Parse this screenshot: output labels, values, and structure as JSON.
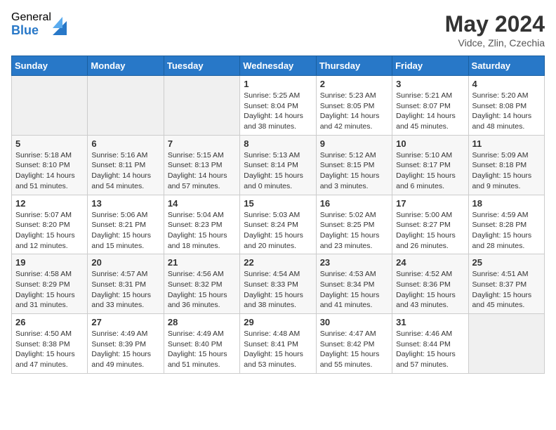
{
  "logo": {
    "general": "General",
    "blue": "Blue"
  },
  "header": {
    "month_year": "May 2024",
    "location": "Vidce, Zlin, Czechia"
  },
  "weekdays": [
    "Sunday",
    "Monday",
    "Tuesday",
    "Wednesday",
    "Thursday",
    "Friday",
    "Saturday"
  ],
  "weeks": [
    [
      {
        "day": "",
        "info": ""
      },
      {
        "day": "",
        "info": ""
      },
      {
        "day": "",
        "info": ""
      },
      {
        "day": "1",
        "info": "Sunrise: 5:25 AM\nSunset: 8:04 PM\nDaylight: 14 hours and 38 minutes."
      },
      {
        "day": "2",
        "info": "Sunrise: 5:23 AM\nSunset: 8:05 PM\nDaylight: 14 hours and 42 minutes."
      },
      {
        "day": "3",
        "info": "Sunrise: 5:21 AM\nSunset: 8:07 PM\nDaylight: 14 hours and 45 minutes."
      },
      {
        "day": "4",
        "info": "Sunrise: 5:20 AM\nSunset: 8:08 PM\nDaylight: 14 hours and 48 minutes."
      }
    ],
    [
      {
        "day": "5",
        "info": "Sunrise: 5:18 AM\nSunset: 8:10 PM\nDaylight: 14 hours and 51 minutes."
      },
      {
        "day": "6",
        "info": "Sunrise: 5:16 AM\nSunset: 8:11 PM\nDaylight: 14 hours and 54 minutes."
      },
      {
        "day": "7",
        "info": "Sunrise: 5:15 AM\nSunset: 8:13 PM\nDaylight: 14 hours and 57 minutes."
      },
      {
        "day": "8",
        "info": "Sunrise: 5:13 AM\nSunset: 8:14 PM\nDaylight: 15 hours and 0 minutes."
      },
      {
        "day": "9",
        "info": "Sunrise: 5:12 AM\nSunset: 8:15 PM\nDaylight: 15 hours and 3 minutes."
      },
      {
        "day": "10",
        "info": "Sunrise: 5:10 AM\nSunset: 8:17 PM\nDaylight: 15 hours and 6 minutes."
      },
      {
        "day": "11",
        "info": "Sunrise: 5:09 AM\nSunset: 8:18 PM\nDaylight: 15 hours and 9 minutes."
      }
    ],
    [
      {
        "day": "12",
        "info": "Sunrise: 5:07 AM\nSunset: 8:20 PM\nDaylight: 15 hours and 12 minutes."
      },
      {
        "day": "13",
        "info": "Sunrise: 5:06 AM\nSunset: 8:21 PM\nDaylight: 15 hours and 15 minutes."
      },
      {
        "day": "14",
        "info": "Sunrise: 5:04 AM\nSunset: 8:23 PM\nDaylight: 15 hours and 18 minutes."
      },
      {
        "day": "15",
        "info": "Sunrise: 5:03 AM\nSunset: 8:24 PM\nDaylight: 15 hours and 20 minutes."
      },
      {
        "day": "16",
        "info": "Sunrise: 5:02 AM\nSunset: 8:25 PM\nDaylight: 15 hours and 23 minutes."
      },
      {
        "day": "17",
        "info": "Sunrise: 5:00 AM\nSunset: 8:27 PM\nDaylight: 15 hours and 26 minutes."
      },
      {
        "day": "18",
        "info": "Sunrise: 4:59 AM\nSunset: 8:28 PM\nDaylight: 15 hours and 28 minutes."
      }
    ],
    [
      {
        "day": "19",
        "info": "Sunrise: 4:58 AM\nSunset: 8:29 PM\nDaylight: 15 hours and 31 minutes."
      },
      {
        "day": "20",
        "info": "Sunrise: 4:57 AM\nSunset: 8:31 PM\nDaylight: 15 hours and 33 minutes."
      },
      {
        "day": "21",
        "info": "Sunrise: 4:56 AM\nSunset: 8:32 PM\nDaylight: 15 hours and 36 minutes."
      },
      {
        "day": "22",
        "info": "Sunrise: 4:54 AM\nSunset: 8:33 PM\nDaylight: 15 hours and 38 minutes."
      },
      {
        "day": "23",
        "info": "Sunrise: 4:53 AM\nSunset: 8:34 PM\nDaylight: 15 hours and 41 minutes."
      },
      {
        "day": "24",
        "info": "Sunrise: 4:52 AM\nSunset: 8:36 PM\nDaylight: 15 hours and 43 minutes."
      },
      {
        "day": "25",
        "info": "Sunrise: 4:51 AM\nSunset: 8:37 PM\nDaylight: 15 hours and 45 minutes."
      }
    ],
    [
      {
        "day": "26",
        "info": "Sunrise: 4:50 AM\nSunset: 8:38 PM\nDaylight: 15 hours and 47 minutes."
      },
      {
        "day": "27",
        "info": "Sunrise: 4:49 AM\nSunset: 8:39 PM\nDaylight: 15 hours and 49 minutes."
      },
      {
        "day": "28",
        "info": "Sunrise: 4:49 AM\nSunset: 8:40 PM\nDaylight: 15 hours and 51 minutes."
      },
      {
        "day": "29",
        "info": "Sunrise: 4:48 AM\nSunset: 8:41 PM\nDaylight: 15 hours and 53 minutes."
      },
      {
        "day": "30",
        "info": "Sunrise: 4:47 AM\nSunset: 8:42 PM\nDaylight: 15 hours and 55 minutes."
      },
      {
        "day": "31",
        "info": "Sunrise: 4:46 AM\nSunset: 8:44 PM\nDaylight: 15 hours and 57 minutes."
      },
      {
        "day": "",
        "info": ""
      }
    ]
  ]
}
